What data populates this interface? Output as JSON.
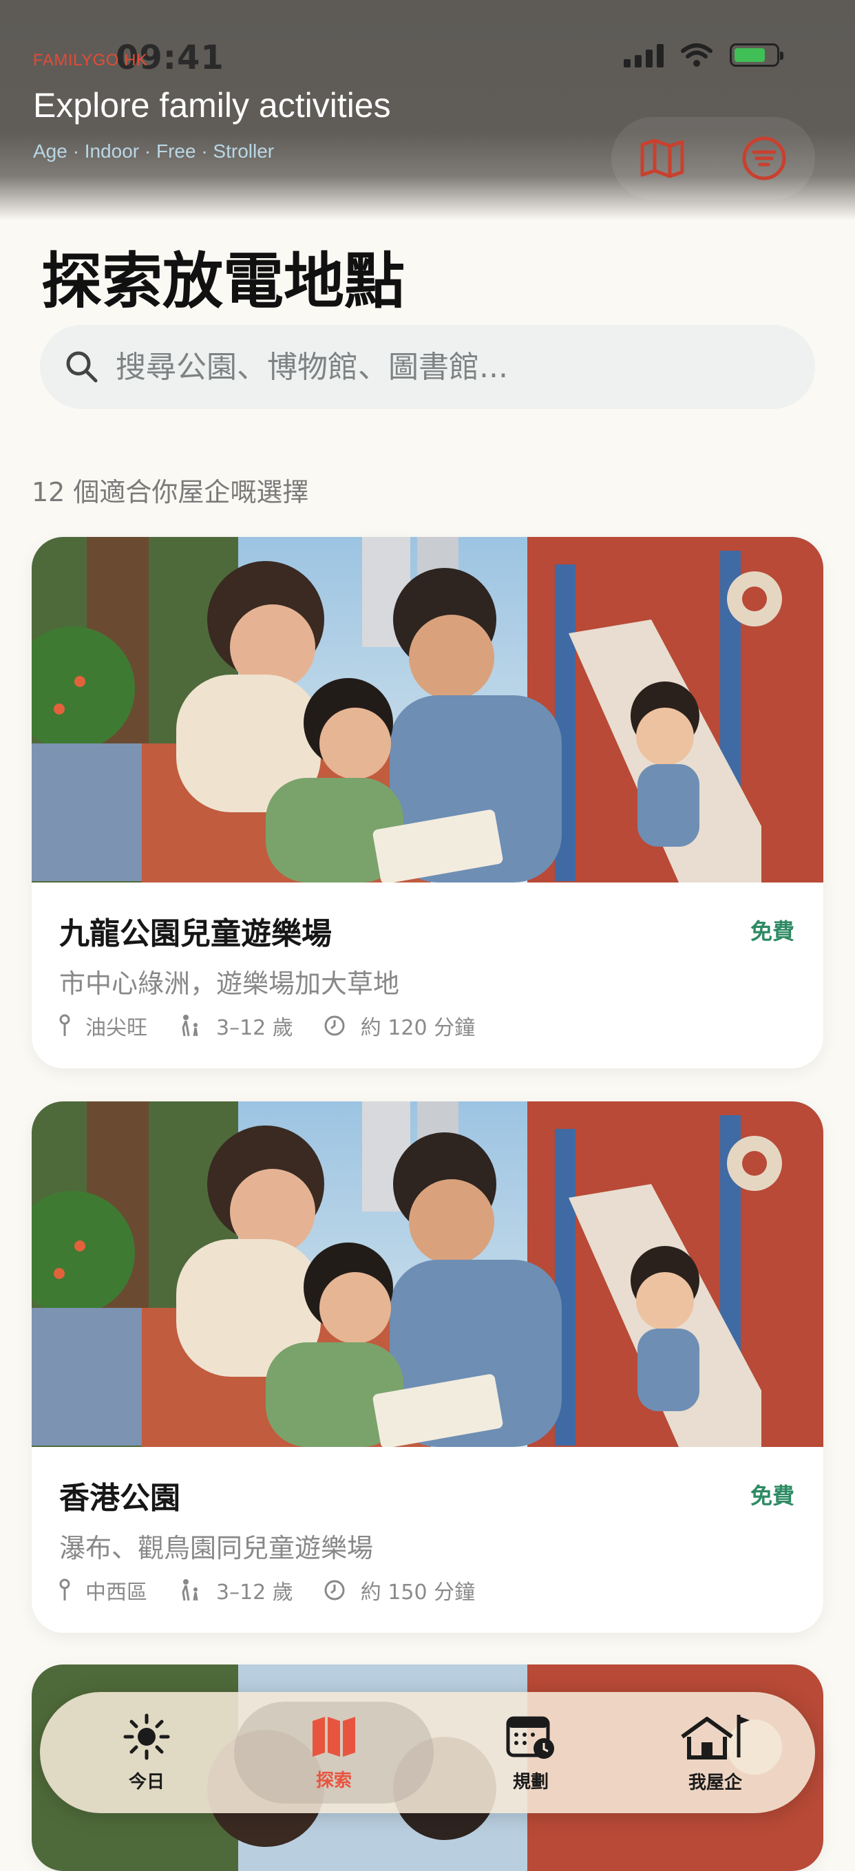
{
  "status_bar": {
    "time": "09:41"
  },
  "header": {
    "brand": "FAMILYGO HK",
    "title": "Explore family activities",
    "subtitle": "Age · Indoor · Free · Stroller",
    "actions": [
      {
        "icon": "map-icon"
      },
      {
        "icon": "filter-icon"
      }
    ]
  },
  "page": {
    "title": "探索放電地點",
    "search_placeholder": "搜尋公園、博物館、圖書館...",
    "results_count": "12 個適合你屋企嘅選擇"
  },
  "cards": [
    {
      "name": "九龍公園兒童遊樂場",
      "price": "免費",
      "description": "市中心綠洲，遊樂場加大草地",
      "district": "油尖旺",
      "age": "3–12 歲",
      "duration": "約 120 分鐘"
    },
    {
      "name": "香港公園",
      "price": "免費",
      "description": "瀑布、觀鳥園同兒童遊樂場",
      "district": "中西區",
      "age": "3–12 歲",
      "duration": "約 150 分鐘"
    }
  ],
  "tabbar": {
    "active": "explore",
    "items": [
      {
        "key": "today",
        "label": "今日",
        "icon": "sun-icon"
      },
      {
        "key": "explore",
        "label": "探索",
        "icon": "map-icon"
      },
      {
        "key": "plan",
        "label": "規劃",
        "icon": "calendar-clock-icon"
      },
      {
        "key": "home",
        "label": "我屋企",
        "icon": "house-flag-icon"
      }
    ]
  },
  "colors": {
    "accent": "#e8553f",
    "free_badge": "#2e8a63",
    "background": "#fbf9f4"
  }
}
